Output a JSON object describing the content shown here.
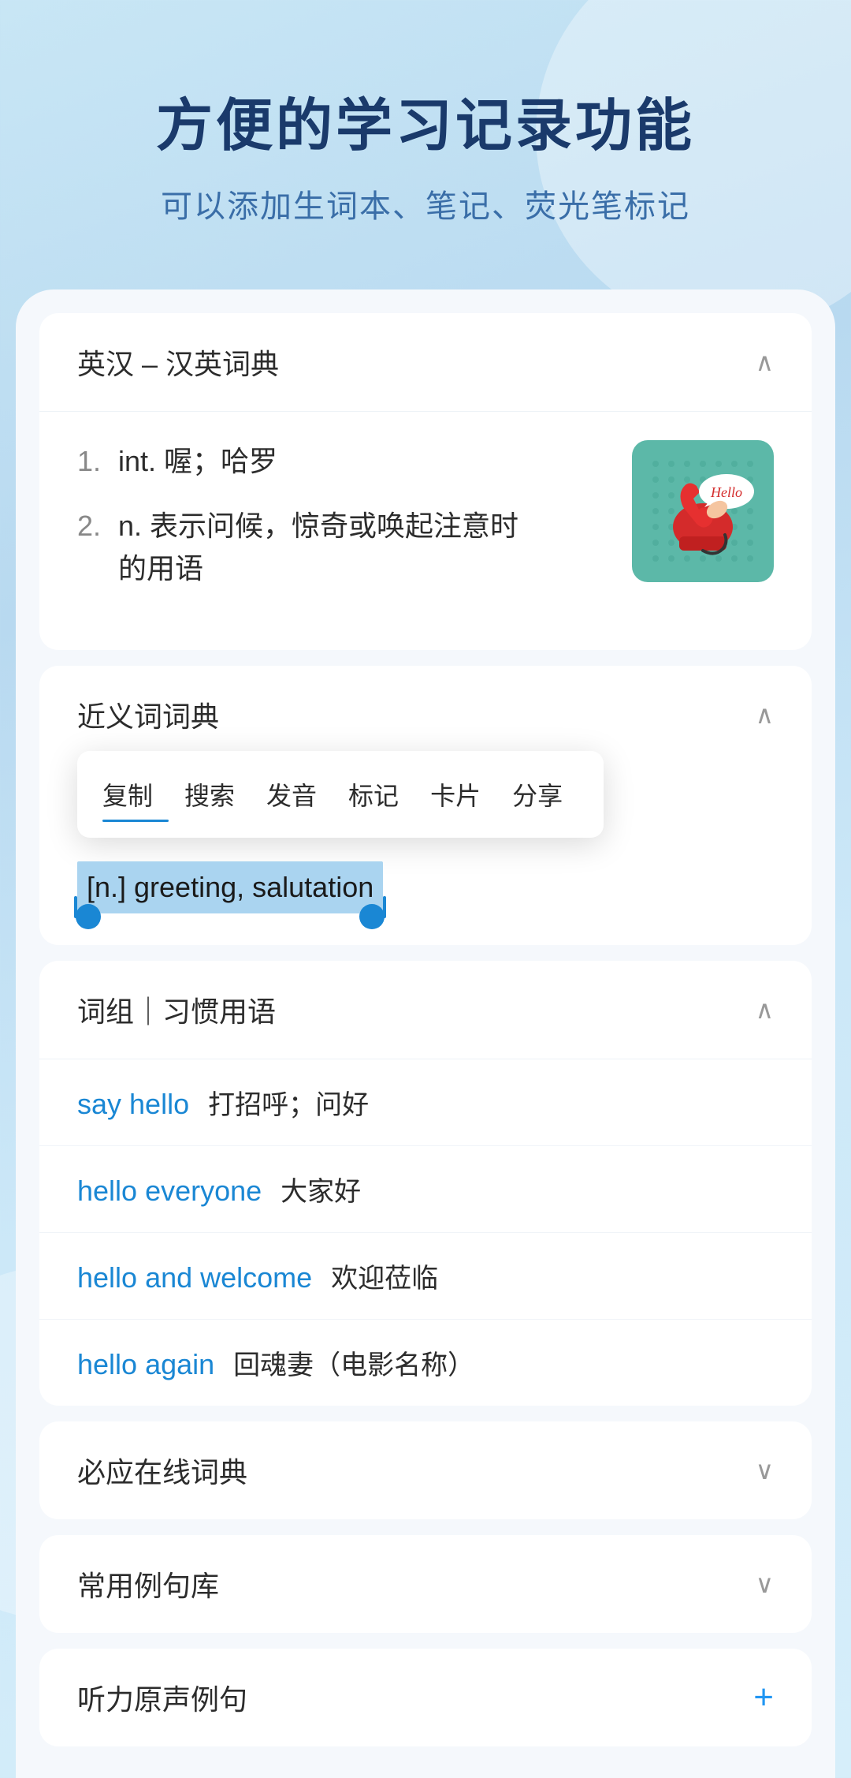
{
  "header": {
    "title": "方便的学习记录功能",
    "subtitle": "可以添加生词本、笔记、荧光笔标记"
  },
  "dict_section": {
    "title": "英汉 – 汉英词典",
    "chevron": "∧",
    "definitions": [
      {
        "num": "1.",
        "type": "int.",
        "text": "喔；哈罗"
      },
      {
        "num": "2.",
        "type": "n.",
        "text": "表示问候，惊奇或唤起注意时的用语"
      }
    ]
  },
  "synonym_section": {
    "title": "近义词词典",
    "chevron": "∧",
    "context_menu": {
      "items": [
        "复制",
        "搜索",
        "发音",
        "标记",
        "卡片",
        "分享"
      ]
    },
    "selected_text": "[n.] greeting, salutation"
  },
  "phrases_section": {
    "title": "词组｜习惯用语",
    "chevron": "∧",
    "phrases": [
      {
        "en": "say hello",
        "cn": "打招呼；问好"
      },
      {
        "en": "hello everyone",
        "cn": "大家好"
      },
      {
        "en": "hello and welcome",
        "cn": "欢迎莅临"
      },
      {
        "en": "hello again",
        "cn": "回魂妻（电影名称）"
      }
    ]
  },
  "collapsed_sections": [
    {
      "title": "必应在线词典",
      "icon": "chevron-down"
    },
    {
      "title": "常用例句库",
      "icon": "chevron-down"
    }
  ],
  "last_section": {
    "title": "听力原声例句",
    "icon": "plus"
  }
}
